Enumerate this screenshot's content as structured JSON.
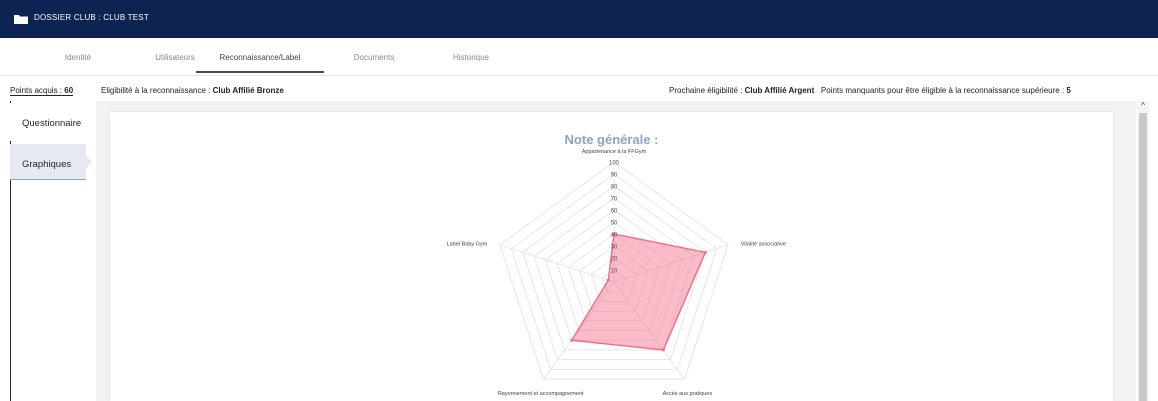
{
  "header": {
    "title": "DOSSIER CLUB : CLUB TEST",
    "icon": "folder-icon"
  },
  "tabs": [
    {
      "label": "Identité"
    },
    {
      "label": "Utilisateurs"
    },
    {
      "label": "Reconnaissance/Label"
    },
    {
      "label": "Documents"
    },
    {
      "label": "Historique"
    }
  ],
  "active_tab": "Reconnaissance/Label",
  "info": {
    "points_label": "Points acquis : ",
    "points_value": "60",
    "eligibility_label": "Eligibilité à la reconnaissance : ",
    "eligibility_value": "Club Affilié Bronze",
    "next_label": "Prochaine éligibilité : ",
    "next_value": "Club Affilié Argent",
    "missing_label": "Points manquants pour être éligible à la reconnaissance supérieure : ",
    "missing_value": "5"
  },
  "sidebar": {
    "items": [
      {
        "label": "Questionnaire"
      },
      {
        "label": "Graphiques"
      }
    ]
  },
  "chart_data": {
    "type": "radar",
    "title": "Note générale :",
    "axes": [
      "Appartenance à la FFGym",
      "Vitalité associative",
      "Accès aux pratiques",
      "Rayonnement et accompagnement",
      "Label Baby Gym"
    ],
    "scale": [
      0,
      100
    ],
    "ticks": [
      10,
      20,
      30,
      40,
      50,
      60,
      70,
      80,
      90,
      100
    ],
    "series": [
      {
        "values": [
          40,
          80,
          70,
          60,
          5
        ],
        "color": "#f26b86"
      }
    ]
  },
  "colors": {
    "header_bg": "#0d2452",
    "title": "#8fa3bd",
    "series_fill": "rgba(242,107,134,0.45)"
  }
}
